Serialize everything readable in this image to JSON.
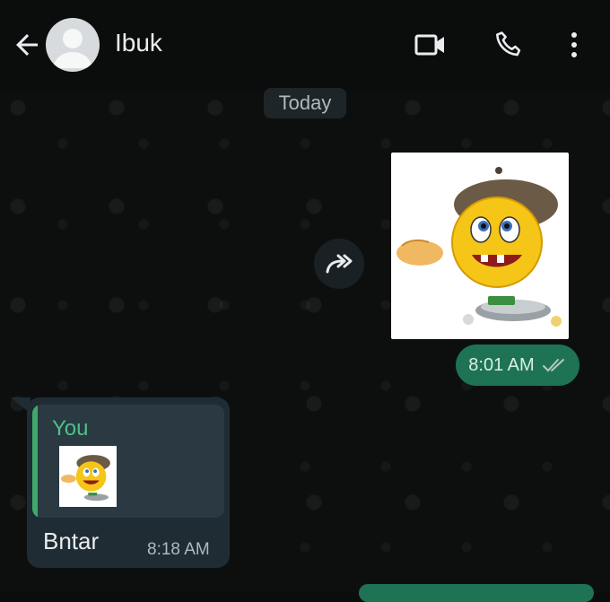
{
  "header": {
    "contact_name": "Ibuk",
    "back_icon": "arrow-left-icon",
    "avatar_icon": "default-avatar-icon",
    "video_icon": "video-camera-icon",
    "call_icon": "phone-icon",
    "menu_icon": "more-vertical-icon"
  },
  "chat": {
    "date_label": "Today",
    "outgoing": {
      "type": "sticker",
      "sticker_icon": "smiley-beret-sticker",
      "time": "8:01 AM",
      "status_icon": "double-check-icon",
      "forward_icon": "forward-icon"
    },
    "incoming": {
      "quoted_author": "You",
      "quoted_thumbnail": "smiley-beret-sticker",
      "text": "Bntar",
      "time": "8:18 AM"
    }
  },
  "colors": {
    "accent_green": "#1f7355",
    "quote_name_green": "#4cc287",
    "bubble_in": "#1f2c33"
  }
}
